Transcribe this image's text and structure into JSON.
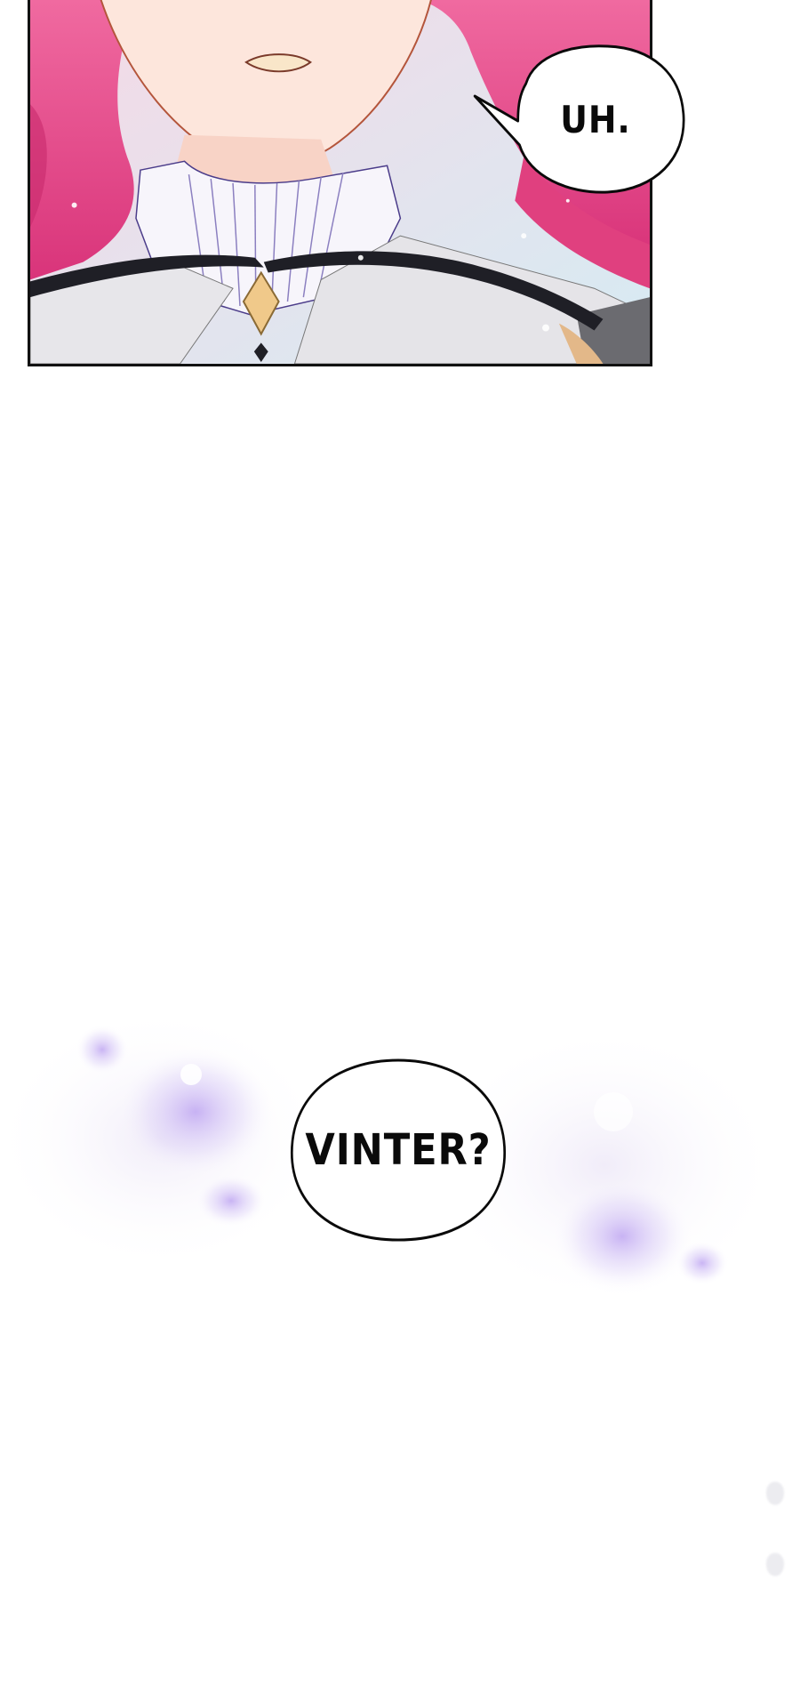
{
  "panel": {
    "description_colors": {
      "hair": "#e94a86",
      "skin": "#fde6dc",
      "collar": "#f7f5fb",
      "strap": "#2a2a33",
      "gem": "#f0c98a",
      "sky": "#dfeef5"
    }
  },
  "bubbles": {
    "first": {
      "text": "UH."
    },
    "second": {
      "text": "VINTER?"
    }
  },
  "haze": {
    "color": "#b79bf0"
  }
}
